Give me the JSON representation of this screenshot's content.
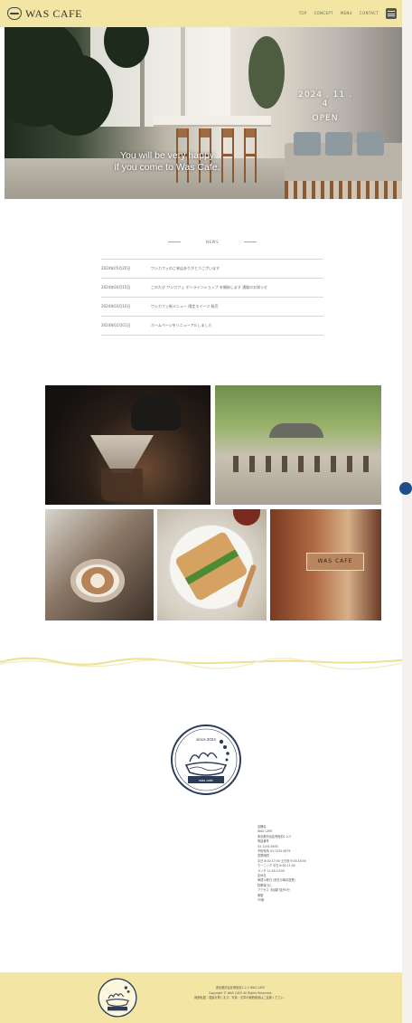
{
  "header": {
    "logo_text": "WAS CAFE",
    "nav": [
      "TOP",
      "CONCEPT",
      "MENU",
      "CONTACT"
    ]
  },
  "hero": {
    "date": "2024 . 11 . 4",
    "open_label": "OPEN",
    "tagline_line1": "You will be very happy",
    "tagline_line2": "if you come to Was Cafe."
  },
  "news": {
    "title": "NEWS",
    "items": [
      {
        "date": "2024年05月20日",
        "text": "ワシカフェのご来店ありがとうございます"
      },
      {
        "date": "2024年04月15日",
        "text": "このたび ワシカフェ オンラインショップ を開始します 通販のお知らせ"
      },
      {
        "date": "2024年03月10日",
        "text": "ワシカフェ新メニュー 限定スイーツ 販売"
      },
      {
        "date": "2024年02月01日",
        "text": "ホームページをリニューアルしました"
      }
    ]
  },
  "gallery": {
    "sign_text": "WAS CAFE"
  },
  "badge": {
    "top_text": "since 2024",
    "bottom_text": "was cafe",
    "stroke_color": "#2b3a55"
  },
  "info": {
    "lines": [
      "店舗名",
      "WAS CAFE",
      "東京都渋谷区神宮前1-2-3",
      "電話番号",
      "03-1234-5678",
      "予約専用 03-1234-5679",
      "営業時間",
      "平日 8:00-17:00  土日祝 9:00-18:00",
      "モーニング 平日 8:00-11:00",
      "ランチ 11:00-15:00",
      "定休日",
      "毎週火曜日 (祝日の場合営業)",
      "駐車場 なし",
      "アクセス 渋谷駅 徒歩5分",
      "席数",
      "30席"
    ]
  },
  "footer": {
    "lines": [
      "東京都渋谷区神宮前1-2-3 WAS CAFE",
      "Copyright © WAS CAFE All Rights Reserved.",
      "無断転載・複製を禁じます。写真・文章の無断使用はご遠慮ください。"
    ]
  },
  "colors": {
    "header_bg": "#f3e6a4",
    "accent_dot": "#1f4f87"
  }
}
